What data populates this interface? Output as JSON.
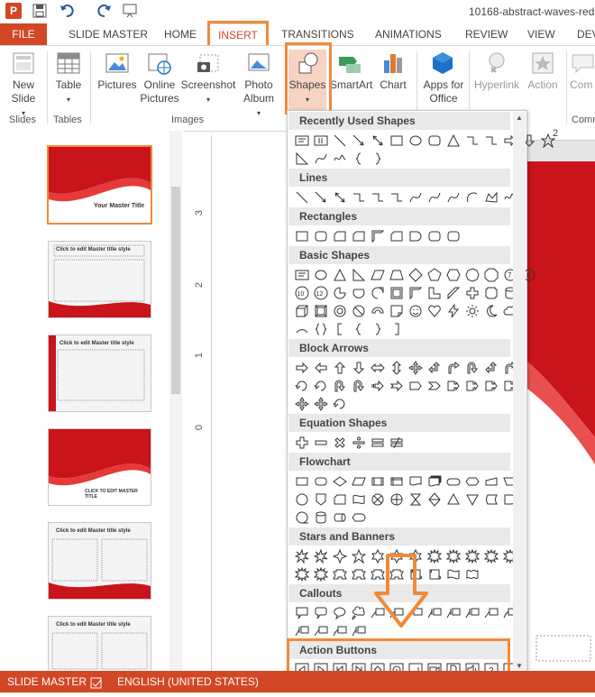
{
  "app_logo": "P",
  "titlebar": {
    "doc_title": "10168-abstract-waves-red-"
  },
  "quick_access": {
    "save_icon": "save-icon",
    "undo_icon": "undo-icon",
    "redo_icon": "redo-icon",
    "present_icon": "present-icon"
  },
  "tabs": [
    "FILE",
    "SLIDE MASTER",
    "HOME",
    "INSERT",
    "TRANSITIONS",
    "ANIMATIONS",
    "REVIEW",
    "VIEW",
    "DEV"
  ],
  "active_tab": "INSERT",
  "ribbon": {
    "new_slide": "New Slide",
    "table": "Table",
    "pictures": "Pictures",
    "online_pictures": "Online Pictures",
    "screenshot": "Screenshot",
    "photo_album": "Photo Album",
    "shapes": "Shapes",
    "smartart": "SmartArt",
    "chart": "Chart",
    "apps_for_office": "Apps for Office",
    "hyperlink": "Hyperlink",
    "action": "Action",
    "comment": "Com",
    "groups": {
      "slides": "Slides",
      "tables": "Tables",
      "images": "Images",
      "comments": "Comm"
    }
  },
  "thumbs": [
    {
      "title": "Your Master Title"
    },
    {
      "title": "Click to edit Master title style"
    },
    {
      "title": "Click to edit Master title style"
    },
    {
      "title": "CLICK TO EDIT MASTER TITLE"
    },
    {
      "title": "Click to edit Master title style"
    },
    {
      "title": "Click to edit Master title style"
    }
  ],
  "ruler": {
    "v": [
      "3",
      "2",
      "1",
      "0"
    ],
    "h_2": "2"
  },
  "shapes_menu": {
    "categories": [
      "Recently Used Shapes",
      "Lines",
      "Rectangles",
      "Basic Shapes",
      "Block Arrows",
      "Equation Shapes",
      "Flowchart",
      "Stars and Banners",
      "Callouts",
      "Action Buttons"
    ]
  },
  "statusbar": {
    "mode": "SLIDE MASTER",
    "language": "ENGLISH (UNITED STATES)"
  },
  "colors": {
    "accent": "#d24726",
    "highlight": "#f08a3a",
    "slide_red": "#c8141a"
  }
}
